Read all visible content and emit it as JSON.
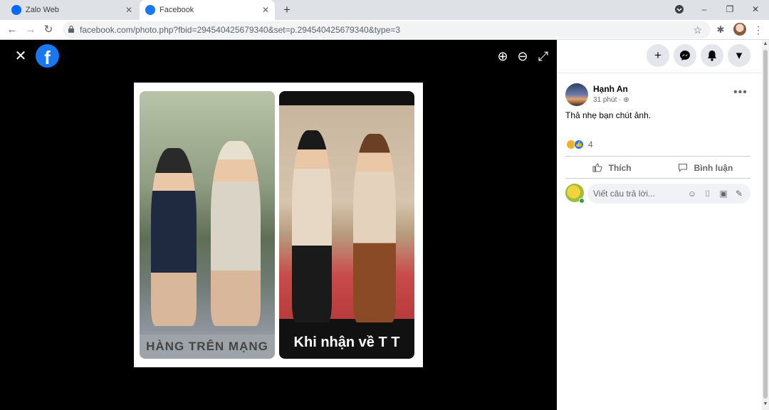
{
  "browser": {
    "tabs": [
      {
        "title": "Zalo Web",
        "favicon_color": "#0068ff"
      },
      {
        "title": "Facebook",
        "favicon_color": "#1877f2"
      }
    ],
    "url": "facebook.com/photo.php?fbid=294540425679340&set=p.294540425679340&type=3",
    "icons": {
      "back": "←",
      "forward": "→",
      "reload": "↻",
      "lock": "lock-icon",
      "star": "☆",
      "extensions": "✱",
      "new_tab": "+",
      "minimize": "–",
      "restore": "❐",
      "close": "✕",
      "menu": "⋮"
    }
  },
  "viewer": {
    "close_icon": "✕",
    "logo_letter": "f",
    "zoom_in_icon": "⊕",
    "zoom_out_icon": "⊖",
    "fullscreen_icon": "⤢",
    "photo": {
      "left_caption": "HÀNG TRÊN MẠNG",
      "right_caption": "Khi nhận về T T"
    }
  },
  "topnav": {
    "create_icon": "+",
    "messenger_icon": "◎",
    "notifications_icon": "🔔",
    "account_icon": "▾"
  },
  "post": {
    "author": "Hạnh An",
    "time": "31 phút · ⊕",
    "text": "Thả nhẹ bạn chút ảnh.",
    "more_icon": "•••",
    "reaction_count": "4",
    "like_label": "Thích",
    "comment_label": "Bình luận",
    "like_icon": "👍",
    "comment_icon": "▭",
    "comment_placeholder": "Viết câu trả lời...",
    "comment_icons": [
      "☺",
      "⌷",
      "▣",
      "✎"
    ]
  },
  "colors": {
    "facebook_blue": "#1877f2",
    "viewer_bg": "#000000",
    "online": "#31a24c"
  }
}
